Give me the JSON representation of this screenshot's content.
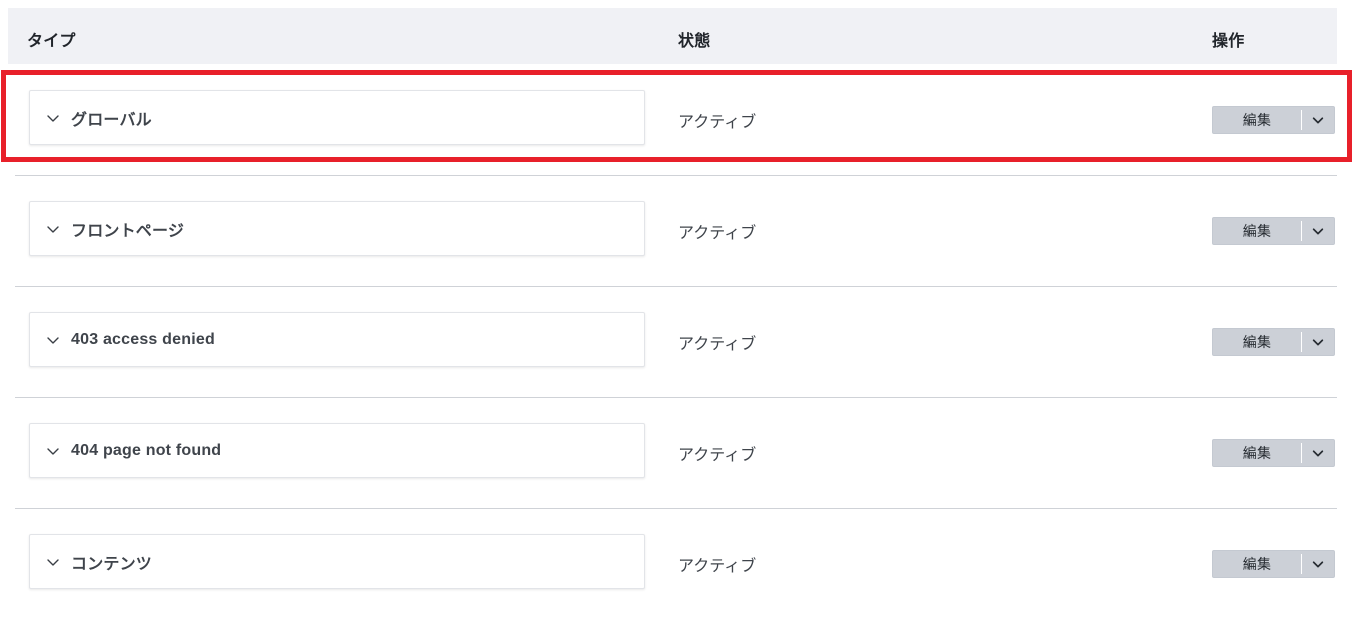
{
  "table": {
    "columns": {
      "type": "タイプ",
      "status": "状態",
      "action": "操作"
    },
    "rows": [
      {
        "type": "グローバル",
        "status": "アクティブ",
        "action_label": "編集",
        "toggle_icon": "chevron-down-icon",
        "caret_icon": "chevron-down-icon",
        "highlighted": true
      },
      {
        "type": "フロントページ",
        "status": "アクティブ",
        "action_label": "編集",
        "toggle_icon": "chevron-down-icon",
        "caret_icon": "chevron-down-icon",
        "highlighted": false
      },
      {
        "type": "403 access denied",
        "status": "アクティブ",
        "action_label": "編集",
        "toggle_icon": "chevron-down-icon",
        "caret_icon": "chevron-down-icon",
        "highlighted": false
      },
      {
        "type": "404 page not found",
        "status": "アクティブ",
        "action_label": "編集",
        "toggle_icon": "chevron-down-icon",
        "caret_icon": "chevron-down-icon",
        "highlighted": false
      },
      {
        "type": "コンテンツ",
        "status": "アクティブ",
        "action_label": "編集",
        "toggle_icon": "chevron-down-icon",
        "caret_icon": "chevron-down-icon",
        "highlighted": false
      }
    ]
  },
  "annotation": {
    "highlight_color": "#e8202a",
    "target_row_index": 0
  },
  "colors": {
    "header_background": "#f0f1f5",
    "page_background": "#ffffff",
    "card_border": "#e2e4e8",
    "row_separator": "#cfd2d7",
    "button_background": "#ccd0d7",
    "text_primary": "#21252b",
    "text_secondary": "#3f444b"
  }
}
